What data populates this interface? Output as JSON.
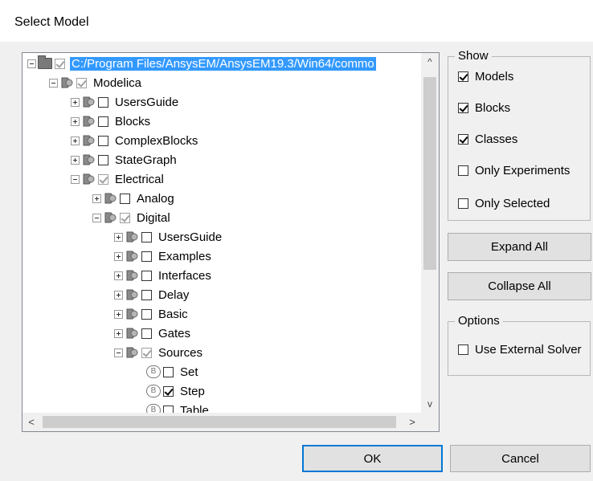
{
  "window": {
    "title": "Select Model"
  },
  "tree": {
    "nodes": [
      {
        "label": "C:/Program Files/AnsysEM/AnsysEM19.3/Win64/commo",
        "checked": true,
        "greyed": true,
        "expanded": true,
        "icon": "folder-icon",
        "selected": true
      },
      {
        "label": "Modelica",
        "checked": true,
        "greyed": true,
        "expanded": true,
        "icon": "package-icon"
      },
      {
        "label": "UsersGuide",
        "checked": false,
        "expanded": false,
        "icon": "package-icon"
      },
      {
        "label": "Blocks",
        "checked": false,
        "expanded": false,
        "icon": "package-icon"
      },
      {
        "label": "ComplexBlocks",
        "checked": false,
        "expanded": false,
        "icon": "package-icon"
      },
      {
        "label": "StateGraph",
        "checked": false,
        "expanded": false,
        "icon": "package-icon"
      },
      {
        "label": "Electrical",
        "checked": true,
        "greyed": true,
        "expanded": true,
        "icon": "package-icon"
      },
      {
        "label": "Analog",
        "checked": false,
        "expanded": false,
        "icon": "package-icon"
      },
      {
        "label": "Digital",
        "checked": true,
        "greyed": true,
        "expanded": true,
        "icon": "package-icon"
      },
      {
        "label": "UsersGuide",
        "checked": false,
        "expanded": false,
        "icon": "package-icon"
      },
      {
        "label": "Examples",
        "checked": false,
        "expanded": false,
        "icon": "package-icon"
      },
      {
        "label": "Interfaces",
        "checked": false,
        "expanded": false,
        "icon": "package-icon"
      },
      {
        "label": "Delay",
        "checked": false,
        "expanded": false,
        "icon": "package-icon"
      },
      {
        "label": "Basic",
        "checked": false,
        "expanded": false,
        "icon": "package-icon"
      },
      {
        "label": "Gates",
        "checked": false,
        "expanded": false,
        "icon": "package-icon"
      },
      {
        "label": "Sources",
        "checked": true,
        "greyed": true,
        "expanded": true,
        "icon": "package-icon"
      },
      {
        "label": "Set",
        "checked": false,
        "icon": "block-icon",
        "badge": "B"
      },
      {
        "label": "Step",
        "checked": true,
        "icon": "block-icon",
        "badge": "B"
      },
      {
        "label": "Table",
        "checked": false,
        "icon": "block-icon",
        "badge": "B"
      }
    ]
  },
  "show": {
    "legend": "Show",
    "models": {
      "label": "Models",
      "checked": true
    },
    "blocks": {
      "label": "Blocks",
      "checked": true
    },
    "classes": {
      "label": "Classes",
      "checked": true
    },
    "only_experiments": {
      "label": "Only Experiments",
      "checked": false
    },
    "only_selected": {
      "label": "Only Selected",
      "checked": false
    }
  },
  "buttons": {
    "expand_all": "Expand All",
    "collapse_all": "Collapse All",
    "ok": "OK",
    "cancel": "Cancel"
  },
  "options": {
    "legend": "Options",
    "use_external_solver": {
      "label": "Use External Solver",
      "checked": false
    }
  },
  "scroll": {
    "up_arrow": "^",
    "down_arrow": "v",
    "left_arrow": "<",
    "right_arrow": ">"
  }
}
